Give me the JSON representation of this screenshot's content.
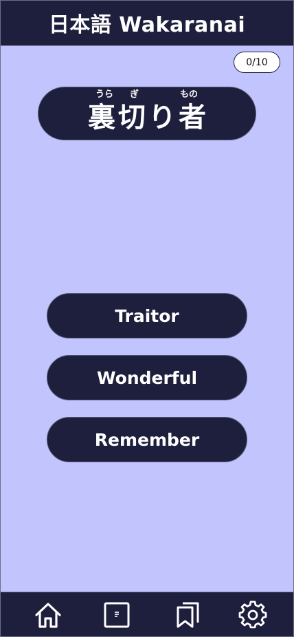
{
  "header": {
    "title": "日本語 Wakaranai"
  },
  "quiz": {
    "progress": "0/10",
    "word": {
      "kanji": [
        "裏",
        "切",
        "り",
        "者"
      ],
      "furigana": [
        {
          "reading": "うら"
        },
        {
          "reading": "ぎ"
        },
        {
          "reading": "もの"
        }
      ]
    },
    "answers": [
      "Traitor",
      "Wonderful",
      "Remember"
    ]
  },
  "nav": {
    "items": [
      {
        "icon": "home-icon"
      },
      {
        "icon": "notes-icon"
      },
      {
        "icon": "bookmarks-icon"
      },
      {
        "icon": "gear-icon"
      }
    ]
  },
  "colors": {
    "background": "#c2c4fd",
    "primary": "#1e1f3d",
    "text": "#ffffff"
  }
}
